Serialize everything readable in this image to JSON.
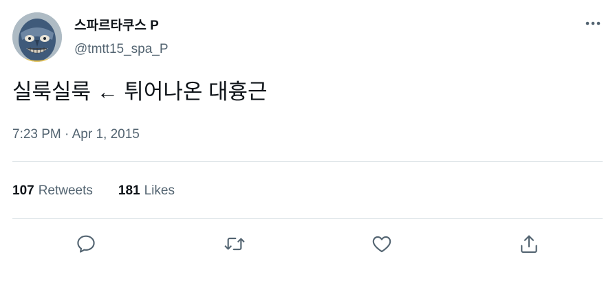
{
  "tweet": {
    "author": {
      "display_name": "스파르타쿠스 P",
      "handle": "@tmtt15_spa_P",
      "avatar_icon": "masked-face-avatar"
    },
    "text": "실룩실룩 ← 튀어나온 대흉근",
    "timestamp": "7:23 PM · Apr 1, 2015",
    "stats": {
      "retweets_count": "107",
      "retweets_label": "Retweets",
      "likes_count": "181",
      "likes_label": "Likes"
    },
    "actions": [
      {
        "name": "reply",
        "icon": "speech-bubble-icon"
      },
      {
        "name": "retweet",
        "icon": "retweet-arrows-icon"
      },
      {
        "name": "like",
        "icon": "heart-icon"
      },
      {
        "name": "share",
        "icon": "share-upload-icon"
      }
    ],
    "more_icon": "ellipsis-icon"
  },
  "colors": {
    "text_primary": "#0f1419",
    "text_secondary": "#536471",
    "divider": "#cfd9de",
    "icon": "#536471"
  }
}
